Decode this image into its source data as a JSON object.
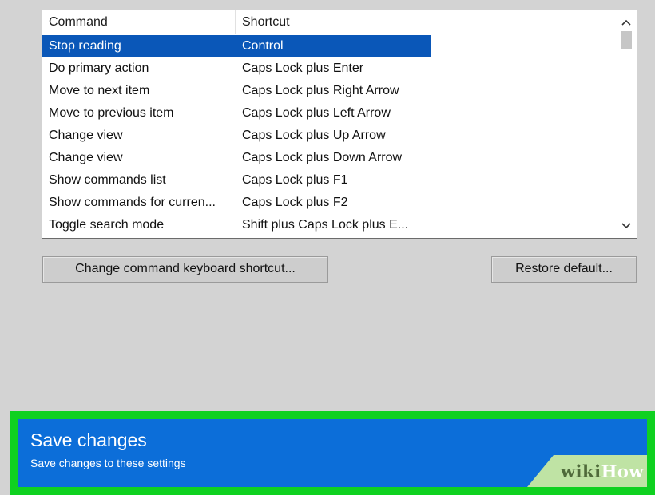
{
  "list": {
    "headers": {
      "command": "Command",
      "shortcut": "Shortcut"
    },
    "rows": [
      {
        "command": "Stop reading",
        "shortcut": "Control",
        "selected": true
      },
      {
        "command": "Do primary action",
        "shortcut": "Caps Lock plus Enter"
      },
      {
        "command": "Move to next item",
        "shortcut": "Caps Lock plus Right Arrow"
      },
      {
        "command": "Move to previous item",
        "shortcut": "Caps Lock plus Left Arrow"
      },
      {
        "command": "Change view",
        "shortcut": "Caps Lock plus Up Arrow"
      },
      {
        "command": "Change view",
        "shortcut": "Caps Lock plus Down Arrow"
      },
      {
        "command": "Show commands list",
        "shortcut": "Caps Lock plus F1"
      },
      {
        "command": "Show commands for curren...",
        "shortcut": "Caps Lock plus F2"
      },
      {
        "command": "Toggle search mode",
        "shortcut": "Shift plus Caps Lock plus E..."
      }
    ]
  },
  "buttons": {
    "change_shortcut": "Change command keyboard shortcut...",
    "restore_default": "Restore default..."
  },
  "save": {
    "title": "Save changes",
    "subtitle": "Save changes to these settings"
  },
  "watermark": {
    "wiki": "wiki",
    "how": "How"
  },
  "colors": {
    "selection": "#0a57b8",
    "save_panel": "#0c6ed9",
    "highlight_border": "#0fd120"
  },
  "icons": {
    "scroll_up": "chevron-up-icon",
    "scroll_down": "chevron-down-icon"
  }
}
